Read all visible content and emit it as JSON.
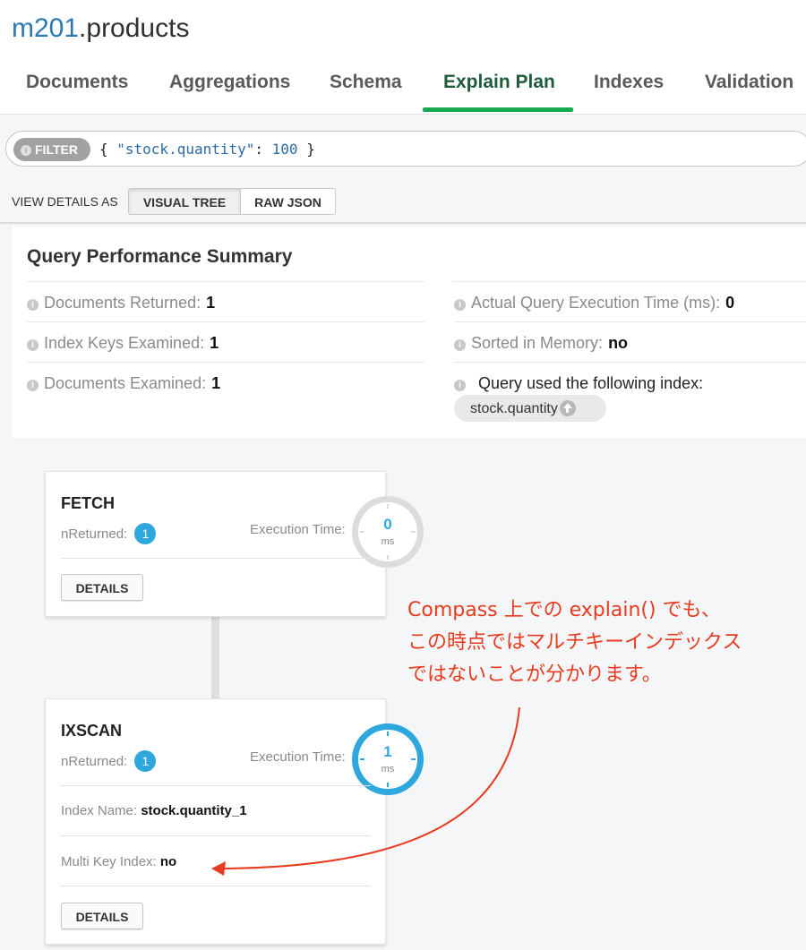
{
  "header": {
    "db_name": "m201",
    "collection_name": ".products",
    "tabs": [
      {
        "label": "Documents"
      },
      {
        "label": "Aggregations"
      },
      {
        "label": "Schema"
      },
      {
        "label": "Explain Plan"
      },
      {
        "label": "Indexes"
      },
      {
        "label": "Validation"
      }
    ],
    "active_tab": "Explain Plan"
  },
  "filter": {
    "pill_label": "FILTER",
    "query_open": "{ ",
    "query_key": "\"stock.quantity\"",
    "query_colon": ": ",
    "query_value": "100",
    "query_close": " }"
  },
  "view_details": {
    "label": "VIEW DETAILS AS",
    "options": [
      "VISUAL TREE",
      "RAW JSON"
    ],
    "selected": "VISUAL TREE"
  },
  "summary": {
    "title": "Query Performance Summary",
    "left": [
      {
        "label": "Documents Returned:",
        "value": "1"
      },
      {
        "label": "Index Keys Examined:",
        "value": "1"
      },
      {
        "label": "Documents Examined:",
        "value": "1"
      }
    ],
    "right": [
      {
        "label": "Actual Query Execution Time (ms):",
        "value": "0"
      },
      {
        "label": "Sorted in Memory:",
        "value": "no"
      }
    ],
    "index_used_label": "Query used the following index:",
    "index_chip": "stock.quantity"
  },
  "stages": [
    {
      "name": "FETCH",
      "nreturned_label": "nReturned:",
      "nreturned": "1",
      "exec_label": "Execution Time:",
      "exec_value": "0",
      "exec_unit": "ms",
      "details_label": "DETAILS"
    },
    {
      "name": "IXSCAN",
      "nreturned_label": "nReturned:",
      "nreturned": "1",
      "exec_label": "Execution Time:",
      "exec_value": "1",
      "exec_unit": "ms",
      "index_name_label": "Index Name:",
      "index_name": "stock.quantity_1",
      "multikey_label": "Multi Key Index:",
      "multikey": "no",
      "details_label": "DETAILS"
    }
  ],
  "annotation": {
    "lines": [
      "Compass 上での explain() でも、",
      "この時点ではマルチキーインデックス",
      "ではないことが分かります。"
    ]
  },
  "colors": {
    "accent_green": "#13aa52",
    "db_blue": "#2a7ab0",
    "badge_blue": "#2ea7dd",
    "annotation_red": "#e63b1f"
  }
}
